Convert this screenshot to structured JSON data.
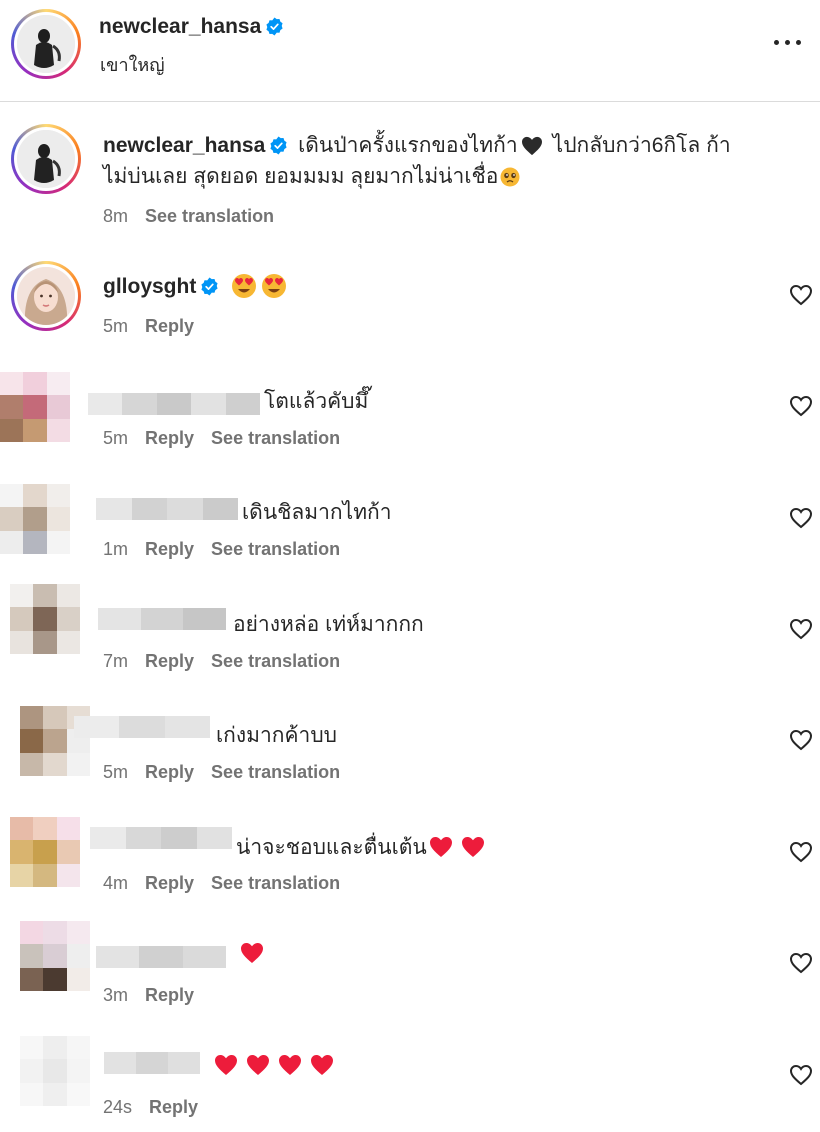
{
  "post": {
    "author": "newclear_hansa",
    "location": "เขาใหญ่"
  },
  "caption": {
    "username": "newclear_hansa",
    "line1": "เดินป่าครั้งแรกของไทก้า",
    "line1_tail": "ไปกลับกว่า6กิโล ก้า",
    "line2": "ไม่บ่นเลย สุดยอด ยอมมมม ลุยมากไม่น่าเชื่อ",
    "time": "8m",
    "see_translation": "See translation"
  },
  "icons": {
    "verified": "verified-badge-icon",
    "more": "more-options-icon",
    "like": "heart-outline-icon",
    "heart_emoji": "red-heart-emoji",
    "black_heart": "black-heart-emoji",
    "heart_eyes": "heart-eyes-emoji",
    "pleading": "pleading-face-emoji"
  },
  "colors": {
    "verified_blue": "#0095f6",
    "meta_gray": "#737373",
    "heart_red": "#ed1c3b"
  },
  "comments": [
    {
      "username": "glloysght",
      "text": "",
      "time": "5m",
      "reply": "Reply"
    },
    {
      "username": "",
      "text": "โตแล้วคับมึ๊",
      "time": "5m",
      "reply": "Reply",
      "see_translation": "See translation"
    },
    {
      "username": "",
      "text": "เดินชิลมากไทก้า",
      "time": "1m",
      "reply": "Reply",
      "see_translation": "See translation"
    },
    {
      "username": "",
      "text": "อย่างหล่อ เท่ห์มากกก",
      "time": "7m",
      "reply": "Reply",
      "see_translation": "See translation"
    },
    {
      "username": "",
      "text": "เก่งมากค้าบบ",
      "time": "5m",
      "reply": "Reply",
      "see_translation": "See translation"
    },
    {
      "username": "",
      "text": "น่าจะชอบและตื่นเต้น",
      "time": "4m",
      "reply": "Reply",
      "see_translation": "See translation"
    },
    {
      "username": "",
      "text": "",
      "time": "3m",
      "reply": "Reply"
    },
    {
      "username": "",
      "text": "",
      "time": "24s",
      "reply": "Reply"
    }
  ]
}
